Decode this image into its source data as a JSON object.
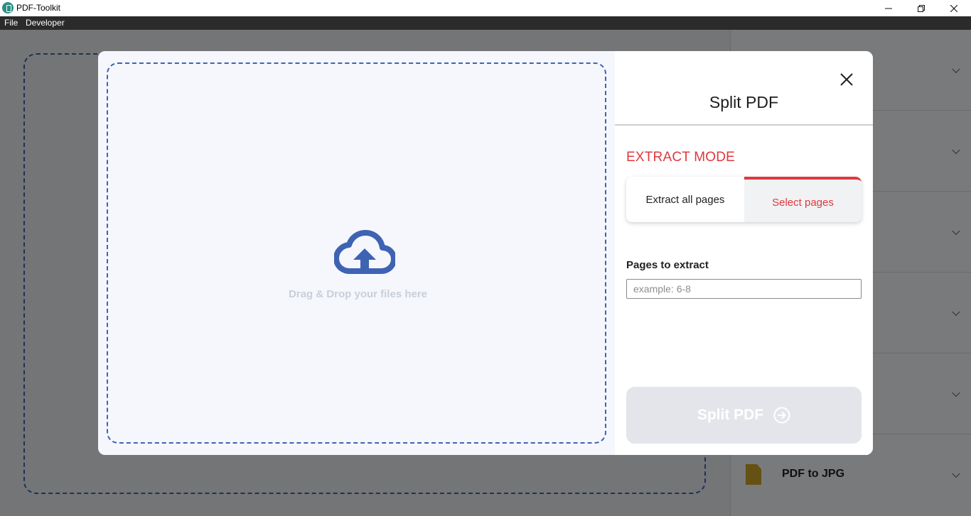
{
  "window": {
    "title": "PDF-Toolkit"
  },
  "menubar": {
    "items": [
      {
        "label": "File"
      },
      {
        "label": "Developer"
      }
    ]
  },
  "background": {
    "sidebar_rows": [
      {
        "label": ""
      },
      {
        "label": ""
      },
      {
        "label": ""
      },
      {
        "label": ""
      },
      {
        "label": ""
      },
      {
        "label": "PDF to JPG",
        "icon": "pdf-file-icon"
      }
    ]
  },
  "modal": {
    "title": "Split PDF",
    "dropzone": {
      "text": "Drag & Drop your files here",
      "icon": "cloud-upload-icon",
      "icon_color": "#3f63b3"
    },
    "extract_mode": {
      "label": "EXTRACT MODE",
      "options": [
        {
          "label": "Extract all pages",
          "selected": false
        },
        {
          "label": "Select pages",
          "selected": true
        }
      ],
      "accent_color": "#e0383e"
    },
    "pages_to_extract": {
      "label": "Pages to extract",
      "value": "",
      "placeholder": "example: 6-8"
    },
    "submit_button": {
      "label": "Split PDF",
      "icon": "arrow-right-circle-icon",
      "disabled": true
    }
  }
}
